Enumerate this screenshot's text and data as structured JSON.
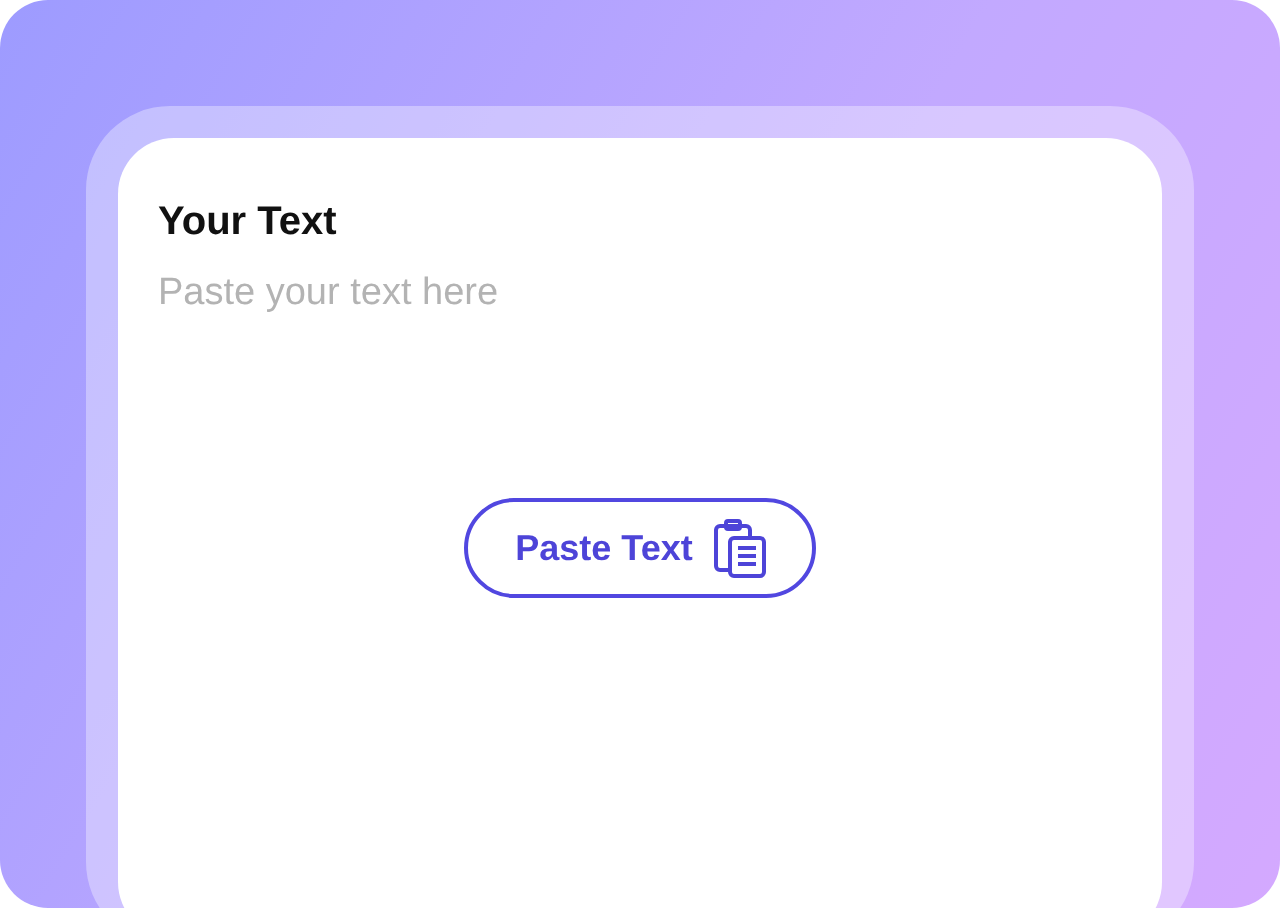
{
  "title": "Your Text",
  "text_field": {
    "placeholder": "Paste your text here"
  },
  "paste_button": {
    "label": "Paste Text"
  }
}
